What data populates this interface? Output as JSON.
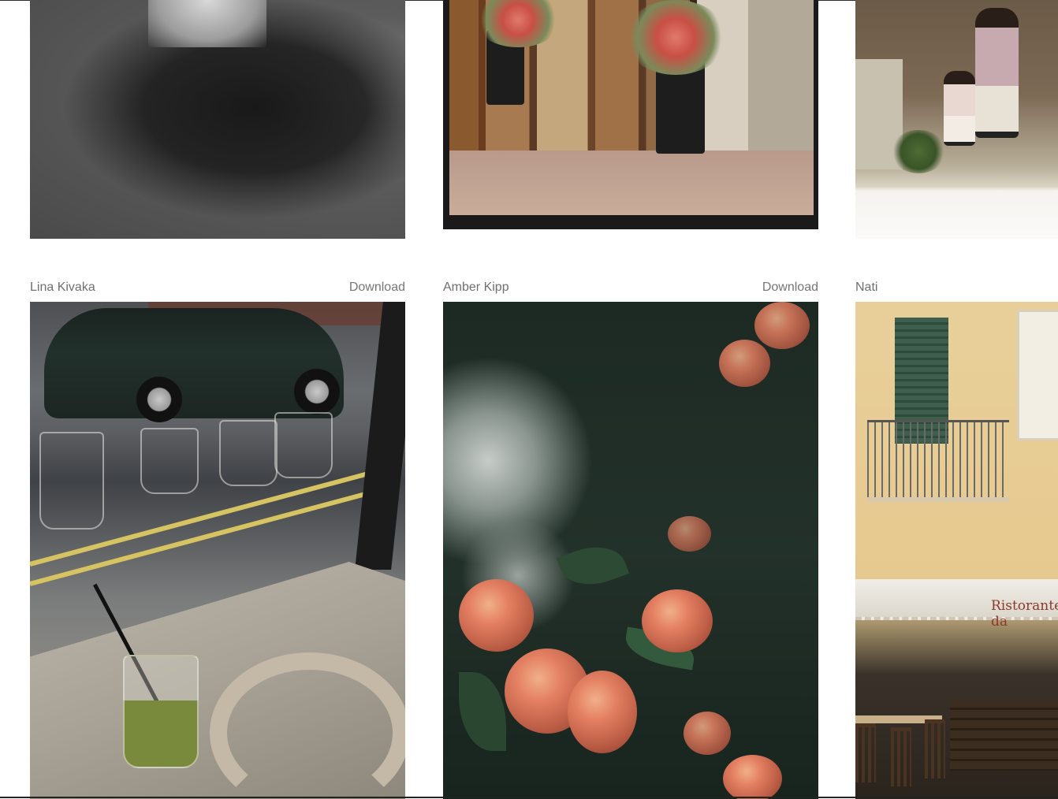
{
  "gallery": {
    "rows": [
      {
        "photos": [
          {
            "alt": "Black and white photo of a person in a dark coat"
          },
          {
            "alt": "Shop window with rubber boots holding flowers"
          },
          {
            "alt": "Woman and child standing beside a wooden wall"
          }
        ]
      },
      {
        "cards": [
          {
            "author": "Lina Kivaka",
            "download_label": "Download",
            "alt": "Cafe window with headphones and a drink"
          },
          {
            "author": "Amber Kipp",
            "download_label": "Download",
            "alt": "Red apples on a tree branch"
          },
          {
            "author": "Nati",
            "alt": "Building facade with balcony and outdoor restaurant"
          }
        ]
      }
    ],
    "restaurant_sign_text": "Ristorante da"
  },
  "colors": {
    "author_text": "#6f6f6f",
    "download_text": "#767676",
    "background": "#ffffff"
  }
}
